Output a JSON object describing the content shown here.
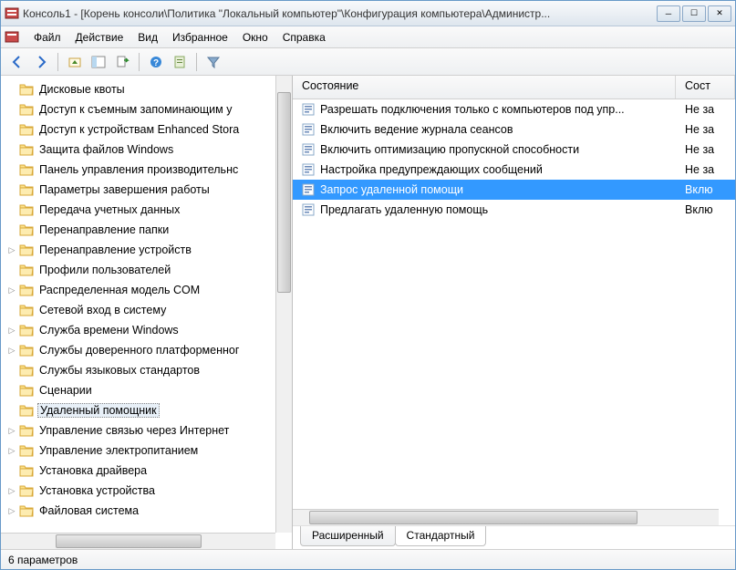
{
  "title": "Консоль1 - [Корень консоли\\Политика \"Локальный компьютер\"\\Конфигурация компьютера\\Администр...",
  "menu": [
    "Файл",
    "Действие",
    "Вид",
    "Избранное",
    "Окно",
    "Справка"
  ],
  "tree": [
    {
      "label": "Дисковые квоты",
      "expand": ""
    },
    {
      "label": "Доступ к съемным запоминающим у",
      "expand": ""
    },
    {
      "label": "Доступ к устройствам Enhanced Stora",
      "expand": ""
    },
    {
      "label": "Защита файлов Windows",
      "expand": ""
    },
    {
      "label": "Панель управления производительнс",
      "expand": ""
    },
    {
      "label": "Параметры завершения работы",
      "expand": ""
    },
    {
      "label": "Передача учетных данных",
      "expand": ""
    },
    {
      "label": "Перенаправление папки",
      "expand": ""
    },
    {
      "label": "Перенаправление устройств",
      "expand": "▷"
    },
    {
      "label": "Профили пользователей",
      "expand": ""
    },
    {
      "label": "Распределенная модель COM",
      "expand": "▷"
    },
    {
      "label": "Сетевой вход в систему",
      "expand": ""
    },
    {
      "label": "Служба времени Windows",
      "expand": "▷"
    },
    {
      "label": "Службы доверенного платформенног",
      "expand": "▷"
    },
    {
      "label": "Службы языковых стандартов",
      "expand": ""
    },
    {
      "label": "Сценарии",
      "expand": ""
    },
    {
      "label": "Удаленный помощник",
      "expand": "",
      "selected": true
    },
    {
      "label": "Управление связью через Интернет",
      "expand": "▷"
    },
    {
      "label": "Управление электропитанием",
      "expand": "▷"
    },
    {
      "label": "Установка драйвера",
      "expand": ""
    },
    {
      "label": "Установка устройства",
      "expand": "▷"
    },
    {
      "label": "Файловая система",
      "expand": "▷"
    }
  ],
  "columns": {
    "c1": "Состояние",
    "c2": "Сост"
  },
  "rows": [
    {
      "c1": "Разрешать подключения только с компьютеров под упр...",
      "c2": "Не за"
    },
    {
      "c1": "Включить ведение журнала сеансов",
      "c2": "Не за"
    },
    {
      "c1": "Включить оптимизацию пропускной способности",
      "c2": "Не за"
    },
    {
      "c1": "Настройка предупреждающих сообщений",
      "c2": "Не за"
    },
    {
      "c1": "Запрос удаленной помощи",
      "c2": "Вклю",
      "selected": true
    },
    {
      "c1": "Предлагать удаленную помощь",
      "c2": "Вклю"
    }
  ],
  "tabs": {
    "t1": "Расширенный",
    "t2": "Стандартный"
  },
  "status": "6 параметров"
}
